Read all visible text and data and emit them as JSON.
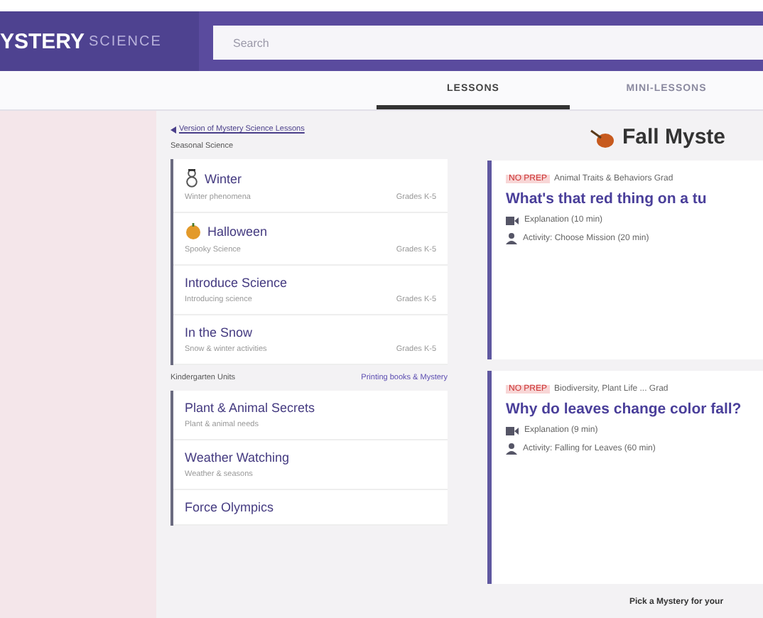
{
  "header": {
    "logo_bold": "YSTERY",
    "logo_light": "SCIENCE",
    "search": {
      "placeholder": "Search"
    }
  },
  "tabs": [
    {
      "label": "LESSONS",
      "selected": true
    },
    {
      "label": "MINI-LESSONS",
      "selected": false
    }
  ],
  "sidebar": {
    "back_link": "Version of Mystery Science Lessons",
    "sections": [
      {
        "title": "Seasonal Science",
        "items": [
          {
            "title": "Winter",
            "subtitle": "Winter phenomena",
            "meta": "Grades K-5"
          },
          {
            "title": "Halloween",
            "subtitle": "Spooky Science",
            "meta": "Grades K-5"
          },
          {
            "title": "Introduce Science",
            "subtitle": "Introducing science",
            "meta": "Grades K-5"
          },
          {
            "title": "In the Snow",
            "subtitle": "Snow & winter activities",
            "meta": "Grades K-5"
          }
        ]
      },
      {
        "title": "Kindergarten Units",
        "action": "Printing books & Mystery",
        "items": [
          {
            "title": "Plant & Animal Secrets",
            "subtitle": "Plant & animal needs"
          },
          {
            "title": "Weather Watching",
            "subtitle": "Weather & seasons"
          },
          {
            "title": "Force Olympics"
          }
        ]
      }
    ]
  },
  "main": {
    "title": "Fall Myste",
    "cards": [
      {
        "tag": "NO PREP",
        "topic": "Animal Traits & Behaviors Grad",
        "question": "What's that red thing on a tu",
        "steps": [
          {
            "kind": "video",
            "text": "Explanation (10 min)"
          },
          {
            "kind": "activity",
            "text": "Activity: Choose Mission (20 min)"
          }
        ]
      },
      {
        "tag": "NO PREP",
        "topic": "Biodiversity, Plant Life ... Grad",
        "question": "Why do leaves change color fall?",
        "steps": [
          {
            "kind": "video",
            "text": "Explanation (9 min)"
          },
          {
            "kind": "activity",
            "text": "Activity: Falling for Leaves (60 min)"
          }
        ]
      }
    ],
    "footer": "Pick a Mystery for your"
  }
}
